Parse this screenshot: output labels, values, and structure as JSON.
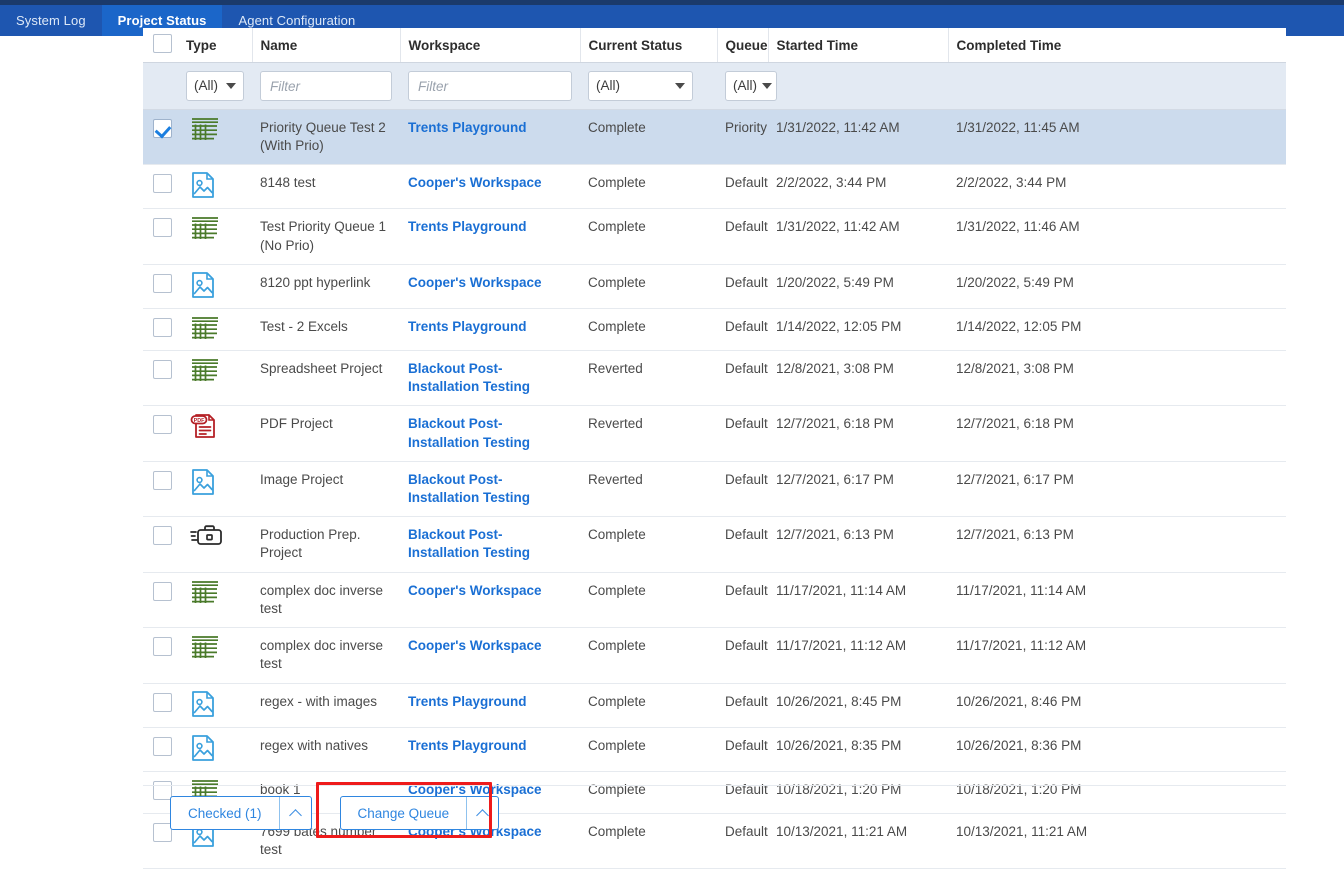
{
  "nav": {
    "tabs": [
      {
        "label": "System Log",
        "active": false
      },
      {
        "label": "Project Status",
        "active": true
      },
      {
        "label": "Agent Configuration",
        "active": false
      }
    ]
  },
  "table": {
    "columns": [
      {
        "key": "check",
        "label": ""
      },
      {
        "key": "type",
        "label": "Type"
      },
      {
        "key": "name",
        "label": "Name"
      },
      {
        "key": "workspace",
        "label": "Workspace"
      },
      {
        "key": "status",
        "label": "Current Status"
      },
      {
        "key": "queue",
        "label": "Queue"
      },
      {
        "key": "started",
        "label": "Started Time"
      },
      {
        "key": "completed",
        "label": "Completed Time"
      }
    ],
    "filters": {
      "type_select": "(All)",
      "name_placeholder": "Filter",
      "name_value": "",
      "workspace_placeholder": "Filter",
      "workspace_value": "",
      "status_select": "(All)",
      "queue_select": "(All)"
    },
    "select_all_checked": false,
    "rows": [
      {
        "checked": true,
        "selected": true,
        "icon": "spreadsheet-icon",
        "name": "Priority Queue Test 2 (With Prio)",
        "workspace": "Trents Playground",
        "status": "Complete",
        "queue": "Priority",
        "started": "1/31/2022, 11:42 AM",
        "completed": "1/31/2022, 11:45 AM"
      },
      {
        "checked": false,
        "selected": false,
        "icon": "image-icon",
        "name": "8148 test",
        "workspace": "Cooper's Workspace",
        "status": "Complete",
        "queue": "Default",
        "started": "2/2/2022, 3:44 PM",
        "completed": "2/2/2022, 3:44 PM"
      },
      {
        "checked": false,
        "selected": false,
        "icon": "spreadsheet-icon",
        "name": "Test Priority Queue 1 (No Prio)",
        "workspace": "Trents Playground",
        "status": "Complete",
        "queue": "Default",
        "started": "1/31/2022, 11:42 AM",
        "completed": "1/31/2022, 11:46 AM"
      },
      {
        "checked": false,
        "selected": false,
        "icon": "image-icon",
        "name": "8120 ppt hyperlink",
        "workspace": "Cooper's Workspace",
        "status": "Complete",
        "queue": "Default",
        "started": "1/20/2022, 5:49 PM",
        "completed": "1/20/2022, 5:49 PM"
      },
      {
        "checked": false,
        "selected": false,
        "icon": "spreadsheet-icon",
        "name": "Test - 2 Excels",
        "workspace": "Trents Playground",
        "status": "Complete",
        "queue": "Default",
        "started": "1/14/2022, 12:05 PM",
        "completed": "1/14/2022, 12:05 PM"
      },
      {
        "checked": false,
        "selected": false,
        "icon": "spreadsheet-icon",
        "name": "Spreadsheet Project",
        "workspace": "Blackout Post-Installation Testing",
        "status": "Reverted",
        "queue": "Default",
        "started": "12/8/2021, 3:08 PM",
        "completed": "12/8/2021, 3:08 PM"
      },
      {
        "checked": false,
        "selected": false,
        "icon": "pdf-icon",
        "name": "PDF Project",
        "workspace": "Blackout Post-Installation Testing",
        "status": "Reverted",
        "queue": "Default",
        "started": "12/7/2021, 6:18 PM",
        "completed": "12/7/2021, 6:18 PM"
      },
      {
        "checked": false,
        "selected": false,
        "icon": "image-icon",
        "name": "Image Project",
        "workspace": "Blackout Post-Installation Testing",
        "status": "Reverted",
        "queue": "Default",
        "started": "12/7/2021, 6:17 PM",
        "completed": "12/7/2021, 6:17 PM"
      },
      {
        "checked": false,
        "selected": false,
        "icon": "production-briefcase-icon",
        "name": "Production Prep. Project",
        "workspace": "Blackout Post-Installation Testing",
        "status": "Complete",
        "queue": "Default",
        "started": "12/7/2021, 6:13 PM",
        "completed": "12/7/2021, 6:13 PM"
      },
      {
        "checked": false,
        "selected": false,
        "icon": "spreadsheet-icon",
        "name": "complex doc inverse test",
        "workspace": "Cooper's Workspace",
        "status": "Complete",
        "queue": "Default",
        "started": "11/17/2021, 11:14 AM",
        "completed": "11/17/2021, 11:14 AM"
      },
      {
        "checked": false,
        "selected": false,
        "icon": "spreadsheet-icon",
        "name": "complex doc inverse test",
        "workspace": "Cooper's Workspace",
        "status": "Complete",
        "queue": "Default",
        "started": "11/17/2021, 11:12 AM",
        "completed": "11/17/2021, 11:12 AM"
      },
      {
        "checked": false,
        "selected": false,
        "icon": "image-icon",
        "name": "regex - with images",
        "workspace": "Trents Playground",
        "status": "Complete",
        "queue": "Default",
        "started": "10/26/2021, 8:45 PM",
        "completed": "10/26/2021, 8:46 PM"
      },
      {
        "checked": false,
        "selected": false,
        "icon": "image-icon",
        "name": "regex with natives",
        "workspace": "Trents Playground",
        "status": "Complete",
        "queue": "Default",
        "started": "10/26/2021, 8:35 PM",
        "completed": "10/26/2021, 8:36 PM"
      },
      {
        "checked": false,
        "selected": false,
        "icon": "spreadsheet-icon",
        "name": "book 1",
        "workspace": "Cooper's Workspace",
        "status": "Complete",
        "queue": "Default",
        "started": "10/18/2021, 1:20 PM",
        "completed": "10/18/2021, 1:20 PM"
      },
      {
        "checked": false,
        "selected": false,
        "icon": "image-icon",
        "name": "7699 bates number test",
        "workspace": "Cooper's Workspace",
        "status": "Complete",
        "queue": "Default",
        "started": "10/13/2021, 11:21 AM",
        "completed": "10/13/2021, 11:21 AM"
      }
    ]
  },
  "footer": {
    "checked_button": "Checked (1)",
    "change_queue_button": "Change Queue"
  },
  "colors": {
    "nav_bar": "#1e56b0",
    "nav_active_tab": "#1b66c9",
    "nav_top_strip": "#1b3a6b",
    "link": "#1a6fd4",
    "selected_row": "#ccdbed",
    "filter_row": "#e3eaf3",
    "button_blue": "#2f86e0",
    "highlight_red": "#ee1b1b",
    "spreadsheet_icon": "#4a7a2a",
    "image_icon": "#3aa0dd",
    "pdf_icon": "#b52026"
  }
}
